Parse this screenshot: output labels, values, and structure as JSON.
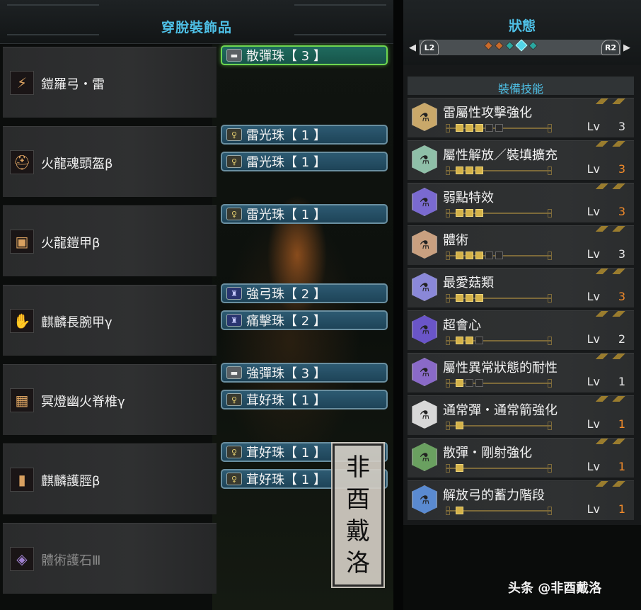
{
  "left_panel": {
    "title": "穿脫裝飾品",
    "equipment": [
      {
        "name": "鎧羅弓・雷",
        "icon": "bow-icon",
        "decorations": [
          {
            "text": "散彈珠【 3 】",
            "slot": 3,
            "selected": true
          }
        ]
      },
      {
        "name": "火龍魂頭盔β",
        "icon": "helm-icon",
        "decorations": [
          {
            "text": "雷光珠【 1 】",
            "slot": 1
          },
          {
            "text": "雷光珠【 1 】",
            "slot": 1
          }
        ]
      },
      {
        "name": "火龍鎧甲β",
        "icon": "chest-icon",
        "decorations": [
          {
            "text": "雷光珠【 1 】",
            "slot": 1
          }
        ]
      },
      {
        "name": "麒麟長腕甲γ",
        "icon": "arm-icon",
        "decorations": [
          {
            "text": "強弓珠【 2 】",
            "slot": 2
          },
          {
            "text": "痛擊珠【 2 】",
            "slot": 2
          }
        ]
      },
      {
        "name": "冥燈幽火脊椎γ",
        "icon": "waist-icon",
        "decorations": [
          {
            "text": "強彈珠【 3 】",
            "slot": 3
          },
          {
            "text": "茸好珠【 1 】",
            "slot": 1
          }
        ]
      },
      {
        "name": "麒麟護脛β",
        "icon": "legs-icon",
        "decorations": [
          {
            "text": "茸好珠【 1 】",
            "slot": 1
          },
          {
            "text": "茸好珠【 1 】",
            "slot": 1
          }
        ]
      },
      {
        "name": "體術護石Ⅲ",
        "icon": "charm-icon",
        "decorations": [],
        "dim": true
      }
    ]
  },
  "stamp": {
    "chars": [
      "非",
      "酉",
      "戴",
      "洛"
    ]
  },
  "right_panel": {
    "title": "狀態",
    "left_shoulder": "L2",
    "right_shoulder": "R2",
    "section_label": "裝備技能",
    "lv_label": "Lv",
    "skills": [
      {
        "name": "雷屬性攻擊強化",
        "level": 3,
        "max": 5,
        "maxed": false,
        "color": "#c9a86a"
      },
      {
        "name": "屬性解放／裝填擴充",
        "level": 3,
        "max": 3,
        "maxed": true,
        "color": "#8fbfa8"
      },
      {
        "name": "弱點特效",
        "level": 3,
        "max": 3,
        "maxed": true,
        "color": "#7a6ad0"
      },
      {
        "name": "體術",
        "level": 3,
        "max": 5,
        "maxed": false,
        "color": "#c9a080"
      },
      {
        "name": "最愛菇類",
        "level": 3,
        "max": 3,
        "maxed": true,
        "color": "#8a88d8"
      },
      {
        "name": "超會心",
        "level": 2,
        "max": 3,
        "maxed": false,
        "color": "#6a55c8"
      },
      {
        "name": "屬性異常狀態的耐性",
        "level": 1,
        "max": 3,
        "maxed": false,
        "color": "#8a6ac8"
      },
      {
        "name": "通常彈・通常箭強化",
        "level": 1,
        "max": 1,
        "maxed": true,
        "color": "#d8d8d8"
      },
      {
        "name": "散彈・剛射強化",
        "level": 1,
        "max": 1,
        "maxed": true,
        "color": "#6aa060"
      },
      {
        "name": "解放弓的蓄力階段",
        "level": 1,
        "max": 1,
        "maxed": true,
        "color": "#5a8ad0"
      }
    ]
  },
  "watermark": "头条 @非酉戴洛"
}
